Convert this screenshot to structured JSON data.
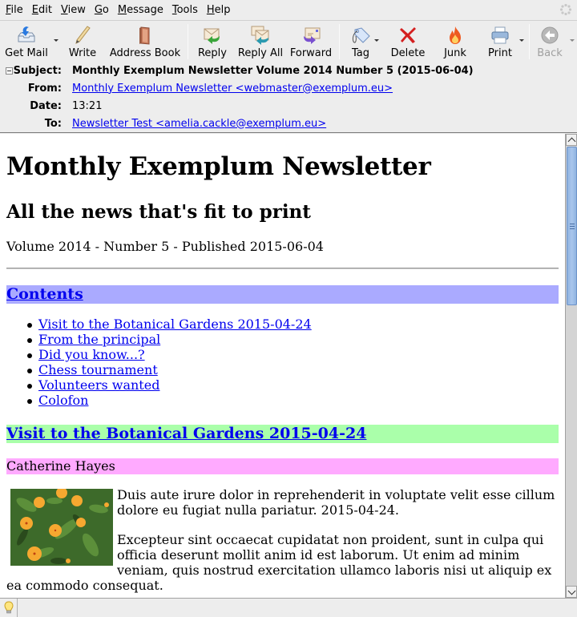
{
  "menubar": {
    "items": [
      {
        "label": "File",
        "accel": "F",
        "rest": "ile"
      },
      {
        "label": "Edit",
        "accel": "E",
        "rest": "dit"
      },
      {
        "label": "View",
        "accel": "V",
        "rest": "iew"
      },
      {
        "label": "Go",
        "accel": "G",
        "rest": "o"
      },
      {
        "label": "Message",
        "accel": "M",
        "rest": "essage"
      },
      {
        "label": "Tools",
        "accel": "T",
        "rest": "ools"
      },
      {
        "label": "Help",
        "accel": "H",
        "rest": "elp"
      }
    ]
  },
  "toolbar": {
    "get_mail": "Get Mail",
    "write": "Write",
    "address_book": "Address Book",
    "reply": "Reply",
    "reply_all": "Reply All",
    "forward": "Forward",
    "tag": "Tag",
    "delete": "Delete",
    "junk": "Junk",
    "print": "Print",
    "back": "Back"
  },
  "headers": {
    "subject_label": "Subject:",
    "subject": "Monthly Exemplum Newsletter Volume 2014 Number 5 (2015-06-04)",
    "from_label": "From:",
    "from": "Monthly Exemplum Newsletter <webmaster@exemplum.eu>",
    "date_label": "Date:",
    "date": "13:21",
    "to_label": "To:",
    "to": "Newsletter Test <amelia.cackle@exemplum.eu>"
  },
  "message": {
    "title": "Monthly Exemplum Newsletter",
    "subtitle": "All the news that's fit to print",
    "volume_line": "Volume 2014 - Number 5 - Published 2015-06-04",
    "contents_heading": "Contents",
    "toc": [
      "Visit to the Botanical Gardens 2015-04-24",
      "From the principal",
      "Did you know...?",
      "Chess tournament",
      "Volunteers wanted",
      "Colofon"
    ],
    "section_heading": "Visit to the Botanical Gardens 2015-04-24",
    "author": "Catherine Hayes",
    "paragraphs": [
      "Duis aute irure dolor in reprehenderit in voluptate velit esse cillum dolore eu fugiat nulla pariatur. 2015-04-24.",
      "Excepteur sint occaecat cupidatat non proident, sunt in culpa qui officia deserunt mollit anim id est laborum. Ut enim ad minim veniam, quis nostrud exercitation ullamco laboris nisi ut aliquip ex ea commodo consequat."
    ],
    "image_subject": "orange marigold flowers"
  },
  "colors": {
    "contents_bar": "#aaaaff",
    "section_bar": "#aaffaa",
    "author_bar": "#ffaaff",
    "link": "#0000ee"
  },
  "scrollbar": {
    "position_fraction": 0.0
  }
}
